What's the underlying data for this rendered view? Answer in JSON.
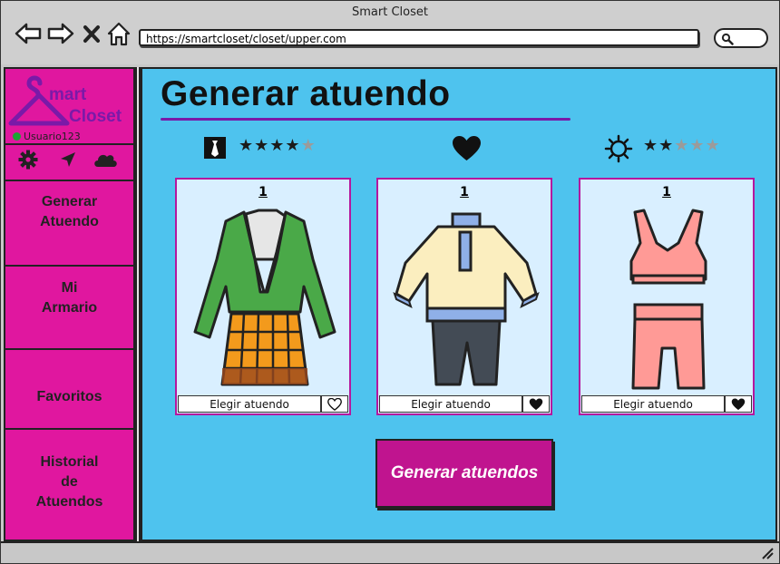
{
  "window": {
    "title": "Smart Closet"
  },
  "browser": {
    "url": "https://smartcloset/closet/upper.com"
  },
  "sidebar": {
    "logo_line1": "mart",
    "logo_line2": "Closet",
    "user": "Usuario123",
    "icons": [
      "gear-icon",
      "location-arrow-icon",
      "cloud-icon"
    ],
    "items": [
      {
        "line1": "Generar",
        "line2": "Atuendo"
      },
      {
        "line1": "Mi",
        "line2": "Armario"
      },
      {
        "line1": "Favoritos"
      },
      {
        "line1": "Historial",
        "line2": "de",
        "line3": "Atuendos"
      }
    ]
  },
  "main": {
    "title": "Generar atuendo",
    "filters": [
      {
        "icon": "tie-icon",
        "rating": 4,
        "max": 5
      },
      {
        "icon": "heart-icon"
      },
      {
        "icon": "sun-icon",
        "rating": 2,
        "max": 5
      }
    ],
    "cards": [
      {
        "number": "1",
        "button": "Elegir atuendo",
        "favorite": false,
        "outfit": "blazer-and-plaid-skirt"
      },
      {
        "number": "1",
        "button": "Elegir atuendo",
        "favorite": true,
        "outfit": "sweater-and-pants"
      },
      {
        "number": "1",
        "button": "Elegir atuendo",
        "favorite": true,
        "outfit": "crop-top-and-shorts"
      }
    ],
    "generate_button": "Generar atuendos"
  },
  "colors": {
    "sidebar": "#e0179f",
    "main_bg": "#4ec3ee",
    "accent": "#7a1aa8",
    "button": "#c0148f"
  }
}
